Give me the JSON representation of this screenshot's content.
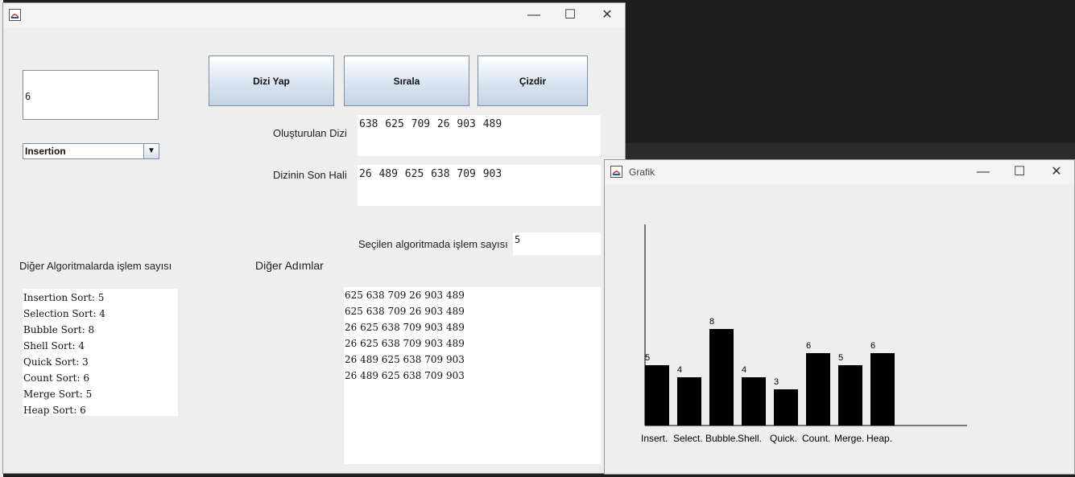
{
  "main_window": {
    "title": "",
    "input_value": "6",
    "algorithm_select": "Insertion",
    "buttons": {
      "make_array": "Dizi Yap",
      "sort": "Sırala",
      "draw": "Çizdir"
    },
    "created_array_label": "Oluşturulan Dizi",
    "created_array_value": "638 625 709 26 903 489",
    "final_array_label": "Dizinin Son Hali",
    "final_array_value": "26 489 625 638 709 903",
    "op_count_label": "Seçilen algoritmada işlem sayısı",
    "op_count_value": "5",
    "other_algos_label": "Diğer Algoritmalarda işlem sayısı",
    "other_steps_label": "Diğer Adımlar",
    "other_algos_lines": [
      "Insertion Sort: 5",
      "Selection Sort: 4",
      "Bubble Sort: 8",
      "Shell Sort: 4",
      "Quick Sort: 3",
      "Count Sort: 6",
      "Merge Sort: 5",
      "Heap Sort: 6"
    ],
    "steps_lines": [
      "625 638 709 26 903 489",
      "625 638 709 26 903 489",
      "26 625 638 709 903 489",
      "26 625 638 709 903 489",
      "26 489 625 638 709 903",
      "26 489 625 638 709 903"
    ]
  },
  "chart_window": {
    "title": "Grafik"
  },
  "window_controls": {
    "minimize": "—",
    "maximize": "☐",
    "close": "✕"
  },
  "chart_data": {
    "type": "bar",
    "categories": [
      "Insert.",
      "Select.",
      "Bubble.",
      "Shell.",
      "Quick.",
      "Count.",
      "Merge.",
      "Heap."
    ],
    "values": [
      5,
      4,
      8,
      4,
      3,
      6,
      5,
      6
    ],
    "bar_color": "#000000",
    "title": "",
    "xlabel": "",
    "ylabel": ""
  }
}
